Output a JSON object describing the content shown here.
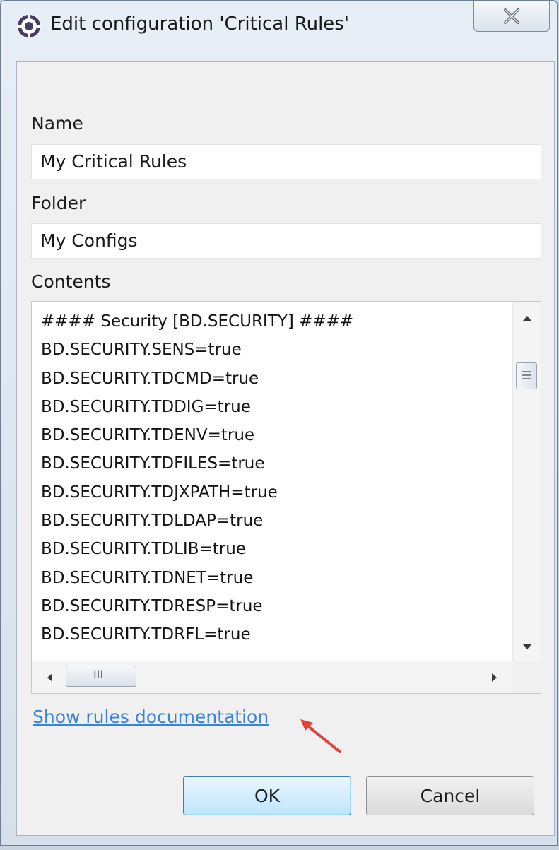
{
  "window": {
    "title": "Edit configuration 'Critical Rules'",
    "close_glyph": "X"
  },
  "form": {
    "name_label": "Name",
    "name_value": "My Critical Rules",
    "folder_label": "Folder",
    "folder_value": "My Configs",
    "contents_label": "Contents",
    "contents_lines": [
      "#### Security [BD.SECURITY] ####",
      "BD.SECURITY.SENS=true",
      "BD.SECURITY.TDCMD=true",
      "BD.SECURITY.TDDIG=true",
      "BD.SECURITY.TDENV=true",
      "BD.SECURITY.TDFILES=true",
      "BD.SECURITY.TDJXPATH=true",
      "BD.SECURITY.TDLDAP=true",
      "BD.SECURITY.TDLIB=true",
      "BD.SECURITY.TDNET=true",
      "BD.SECURITY.TDRESP=true",
      "BD.SECURITY.TDRFL=true"
    ],
    "hscroll_grip": "III",
    "doc_link": "Show rules documentation"
  },
  "buttons": {
    "ok_label": "OK",
    "cancel_label": "Cancel"
  },
  "colors": {
    "link": "#3a83dd",
    "annotation_arrow": "#e2413a",
    "ok_button": "#bee6fd"
  },
  "icons": [
    "app-gear-icon",
    "close-icon",
    "scroll-up-icon",
    "scroll-down-icon",
    "scroll-left-icon",
    "scroll-right-icon",
    "annotation-arrow-icon"
  ]
}
